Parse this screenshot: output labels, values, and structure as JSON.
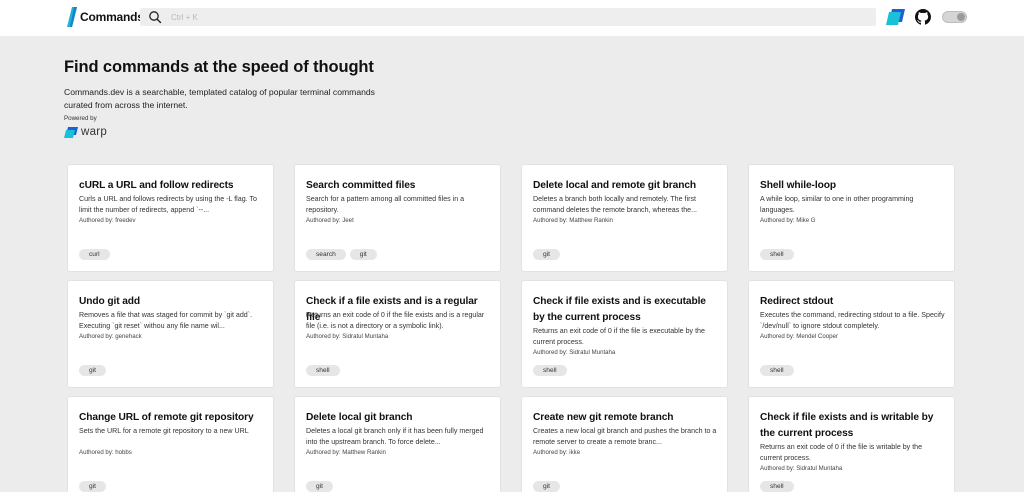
{
  "header": {
    "app_title": "Commands",
    "search_placeholder": "Ctrl + K"
  },
  "hero": {
    "title": "Find commands at the speed of thought",
    "description": "Commands.dev is a searchable, templated catalog of popular terminal commands curated from across the internet.",
    "powered_by": "Powered by",
    "warp_label": "warp"
  },
  "colors": {
    "brand_cyan": "#19b4d7",
    "brand_blue": "#1f5fd6"
  },
  "cards": [
    {
      "title": "cURL a URL and follow redirects",
      "description": "Curls a URL and follows redirects by using the -L flag. To limit the number of redirects, append `--...",
      "author": "Authored by: freedev",
      "tags": [
        "curl"
      ]
    },
    {
      "title": "Search committed files",
      "description": "Search for a pattern among all committed files in a repository.",
      "author": "Authored by: Jeet",
      "tags": [
        "search",
        "git"
      ]
    },
    {
      "title": "Delete local and remote git branch",
      "description": "Deletes a branch both locally and remotely. The first command deletes the remote branch, whereas the...",
      "author": "Authored by: Matthew Rankin",
      "tags": [
        "git"
      ]
    },
    {
      "title": "Shell while-loop",
      "description": "A while loop, similar to one in other programming languages.",
      "author": "Authored by: Mike G",
      "tags": [
        "shell"
      ]
    },
    {
      "title": "Undo git add",
      "description": "Removes a file that was staged for commit by `git add`. Executing `git reset` withou any file name wil...",
      "author": "Authored by: genehack",
      "tags": [
        "git"
      ]
    },
    {
      "title": "Check if a file exists and is a regular file",
      "description": "Returns an exit code of 0 if the file exists and is a regular file (i.e. is not a directory or a symbolic link).",
      "author": "Authored by: Sidratul Muntaha",
      "tags": [
        "shell"
      ]
    },
    {
      "title": "Check if file exists and is executable by the current process",
      "description": "Returns an exit code of 0 if the file is executable by the current process.",
      "author": "Authored by: Sidratul Muntaha",
      "tags": [
        "shell"
      ]
    },
    {
      "title": "Redirect stdout",
      "description": "Executes the command, redirecting stdout to a file. Specify `/dev/null` to ignore stdout completely.",
      "author": "Authored by: Mendel Cooper",
      "tags": [
        "shell"
      ]
    },
    {
      "title": "Change URL of remote git repository",
      "description": "Sets the URL for a remote git repository to a new URL",
      "author": "Authored by: hobbs",
      "tags": [
        "git"
      ]
    },
    {
      "title": "Delete local git branch",
      "description": "Deletes a local git branch only if it has been fully merged into the upstream branch. To force delete...",
      "author": "Authored by: Matthew Rankin",
      "tags": [
        "git"
      ]
    },
    {
      "title": "Create new git remote branch",
      "description": "Creates a new local git branch and pushes the branch to a remote server to create a remote branc...",
      "author": "Authored by: ikke",
      "tags": [
        "git"
      ]
    },
    {
      "title": "Check if file exists and is writable by the current process",
      "description": "Returns an exit code of 0 if the file is writable by the current process.",
      "author": "Authored by: Sidratul Muntaha",
      "tags": [
        "shell"
      ]
    }
  ]
}
